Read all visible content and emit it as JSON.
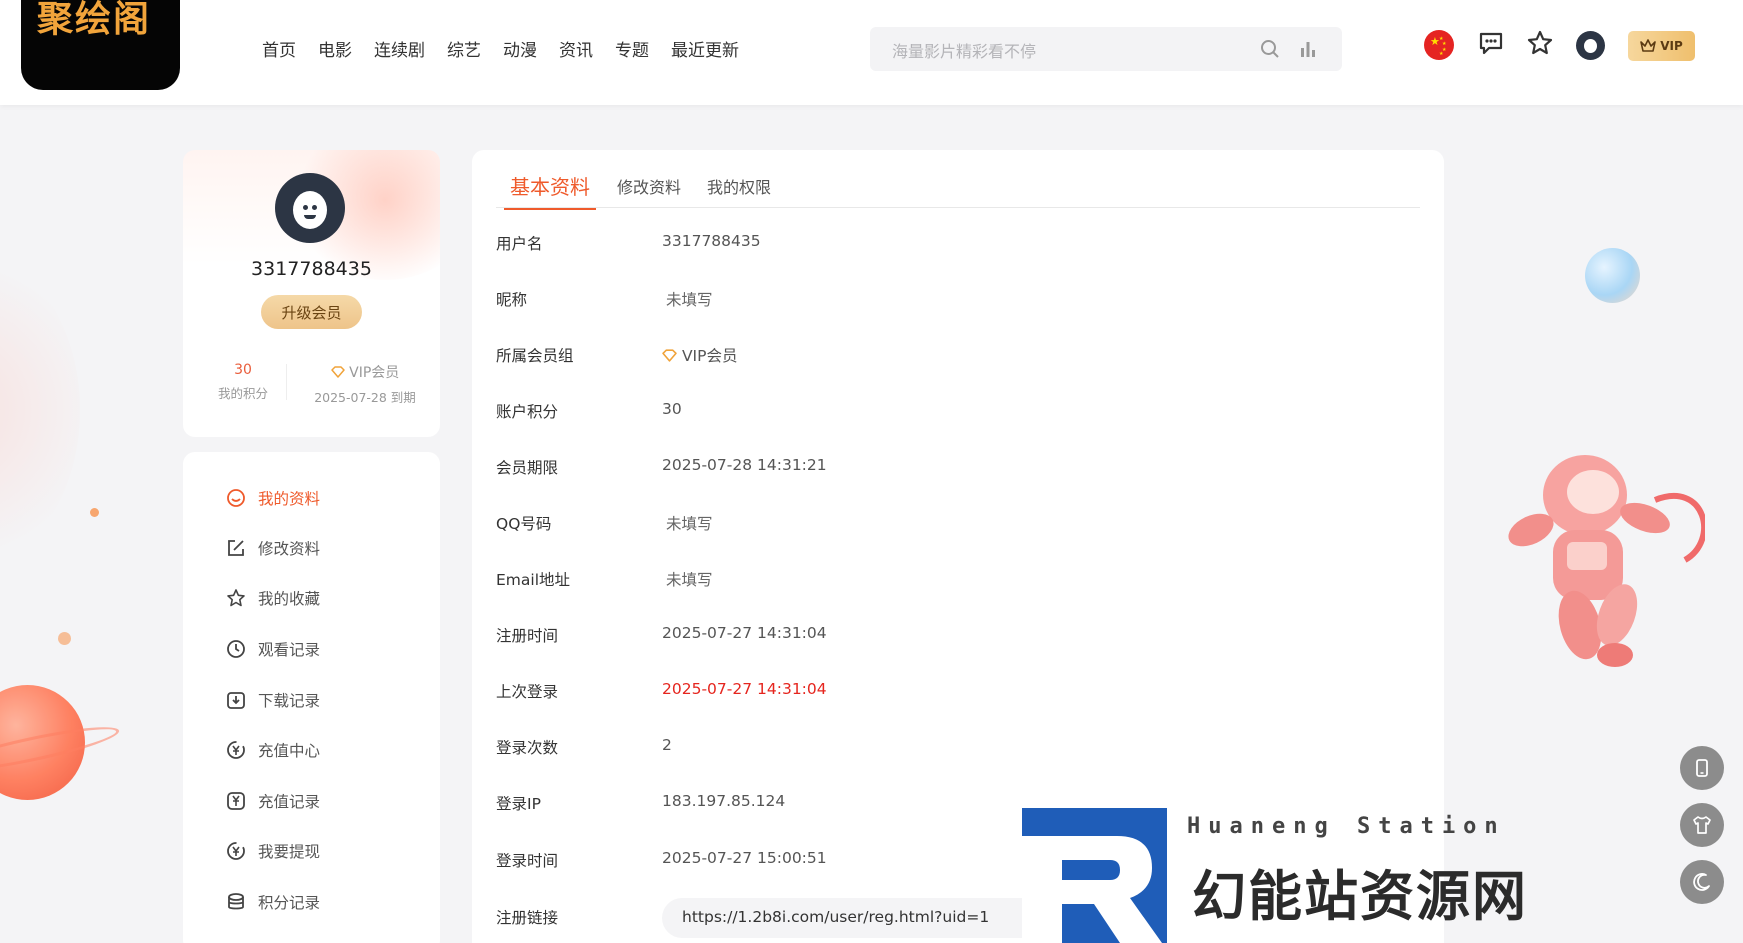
{
  "header": {
    "logo_text": "聚绘阁",
    "nav": [
      "首页",
      "电影",
      "连续剧",
      "综艺",
      "动漫",
      "资讯",
      "专题",
      "最近更新"
    ],
    "search_placeholder": "海量影片精彩看不停",
    "vip_label": "VIP"
  },
  "profile": {
    "username": "3317788435",
    "upgrade_label": "升级会员",
    "points_value": "30",
    "points_label": "我的积分",
    "vip_value": "VIP会员",
    "vip_expiry": "2025-07-28 到期"
  },
  "menu": {
    "items": [
      {
        "label": "我的资料",
        "icon": "smile-icon",
        "active": true
      },
      {
        "label": "修改资料",
        "icon": "edit-icon",
        "active": false
      },
      {
        "label": "我的收藏",
        "icon": "star-icon",
        "active": false
      },
      {
        "label": "观看记录",
        "icon": "clock-icon",
        "active": false
      },
      {
        "label": "下载记录",
        "icon": "download-icon",
        "active": false
      },
      {
        "label": "充值中心",
        "icon": "recharge-icon",
        "active": false
      },
      {
        "label": "充值记录",
        "icon": "yen-icon",
        "active": false
      },
      {
        "label": "我要提现",
        "icon": "withdraw-icon",
        "active": false
      },
      {
        "label": "积分记录",
        "icon": "database-icon",
        "active": false
      }
    ]
  },
  "tabs": [
    "基本资料",
    "修改资料",
    "我的权限"
  ],
  "info": {
    "rows": [
      {
        "key": "用户名",
        "value": "3317788435"
      },
      {
        "key": "昵称",
        "value": "未填写"
      },
      {
        "key": "所属会员组",
        "value": "VIP会员"
      },
      {
        "key": "账户积分",
        "value": "30"
      },
      {
        "key": "会员期限",
        "value": "2025-07-28 14:31:21"
      },
      {
        "key": "QQ号码",
        "value": "未填写"
      },
      {
        "key": "Email地址",
        "value": "未填写"
      },
      {
        "key": "注册时间",
        "value": "2025-07-27 14:31:04"
      },
      {
        "key": "上次登录",
        "value": "2025-07-27 14:31:04"
      },
      {
        "key": "登录次数",
        "value": "2"
      },
      {
        "key": "登录IP",
        "value": "183.197.85.124"
      },
      {
        "key": "登录时间",
        "value": "2025-07-27 15:00:51"
      },
      {
        "key": "注册链接",
        "value": "https://1.2b8i.com/user/reg.html?uid=1"
      }
    ]
  },
  "brand": {
    "en": "Huaneng Station",
    "zh": "幻能站资源网"
  },
  "colors": {
    "accent": "#ef5a2b",
    "danger": "#e5251e",
    "gold": "#efbf6d"
  }
}
